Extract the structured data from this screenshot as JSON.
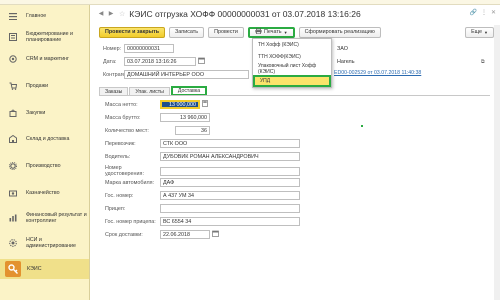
{
  "sidebar": {
    "items": [
      {
        "label": "Главное",
        "icon": "menu-lines-icon"
      },
      {
        "label": "Бюджетирование и планирование",
        "icon": "budget-icon"
      },
      {
        "label": "CRM и маркетинг",
        "icon": "crm-icon"
      },
      {
        "label": "Продажи",
        "icon": "sales-icon"
      },
      {
        "label": "Закупки",
        "icon": "purchase-icon"
      },
      {
        "label": "Склад и доставка",
        "icon": "warehouse-icon"
      },
      {
        "label": "Производство",
        "icon": "production-icon"
      },
      {
        "label": "Казначейство",
        "icon": "treasury-icon"
      },
      {
        "label": "Финансовый результат и контроллинг",
        "icon": "finance-icon"
      },
      {
        "label": "НСИ и администрирование",
        "icon": "settings-icon"
      },
      {
        "label": "КЭИС",
        "icon": "keis-icon"
      }
    ]
  },
  "window": {
    "title": "КЭИС отгрузка ХОФФ 00000000031 от 03.07.2018 13:16:26"
  },
  "toolbar": {
    "post_close": "Провести и закрыть",
    "save": "Записать",
    "post": "Провести",
    "print": "Печать",
    "form_sale": "Сформировать реализацию",
    "more": "Еще"
  },
  "print_menu": {
    "items": [
      "ТН Хофф (КЭИС)",
      "ТТН ХОФФ(КЭИС)",
      "Упаковочный лист Хофф (КЭИС)",
      "УПД"
    ]
  },
  "header": {
    "number_label": "Номер:",
    "number_value": "00000000031",
    "date_label": "Дата:",
    "date_value": "03.07.2018 13:16:26",
    "contractor_label": "Контрагент:",
    "contractor_value": "ДОМАШНИЙ ИНТЕРЬЕР ООО",
    "org_value": "ЗАО",
    "org2_value": "Нагель",
    "link_text": "ЕD00-002529 от 03.07.2018 11:40:38"
  },
  "tabs": [
    "Заказы",
    "Упак. листы",
    "Доставка"
  ],
  "delivery": {
    "net_weight_label": "Масса нетто:",
    "net_weight_value": "13 000,000",
    "gross_weight_label": "Масса брутто:",
    "gross_weight_value": "13 960,000",
    "places_label": "Количество мест:",
    "places_value": "36",
    "carrier_label": "Перевозчик:",
    "carrier_value": "СТК ООО",
    "driver_label": "Водитель:",
    "driver_value": "ДУБОВИК РОМАН АЛЕКСАНДРОВИЧ",
    "id_label": "Номер удостоверения:",
    "id_value": "",
    "car_brand_label": "Марка автомобиля:",
    "car_brand_value": "ДАФ",
    "car_number_label": "Гос. номер:",
    "car_number_value": "А 437 УМ 34",
    "trailer_label": "Прицеп:",
    "trailer_value": "",
    "trailer_number_label": "Гос. номер прицепа:",
    "trailer_number_value": "ВС 6554 34",
    "delivery_term_label": "Срок доставки:",
    "delivery_term_value": "22.06.2018"
  },
  "colors": {
    "sidebar_bg": "#fbf3c7",
    "primary_button": "#f2cc2a",
    "highlight_green": "#2bab42",
    "menu_selected": "#fbe46b",
    "active_section": "#e3922f"
  }
}
